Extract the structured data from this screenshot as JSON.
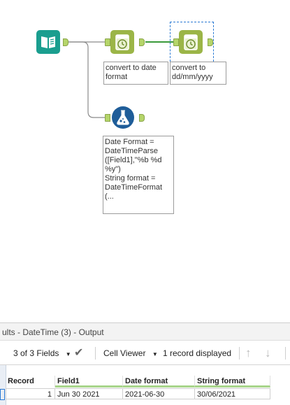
{
  "workflow": {
    "annotation_convert_date": "convert to date\nformat",
    "annotation_convert_ddmm": "convert to\ndd/mm/yyyy",
    "annotation_formula": "Date Format =\nDateTimeParse\n([Field1],\"%b %d\n%y\")\nString format =\nDateTimeFormat\n(..."
  },
  "results": {
    "title": "ults - DateTime (3) - Output",
    "fields_label": "3 of 3 Fields",
    "cell_viewer_label": "Cell Viewer",
    "records_label": "1 record displayed",
    "columns": [
      "Record",
      "Field1",
      "Date format",
      "String format"
    ],
    "rows": [
      [
        "1",
        "Jun 30 2021",
        "2021-06-30",
        "30/06/2021"
      ]
    ]
  },
  "colors": {
    "input_tool": "#1a9e8f",
    "datetime_tool": "#9bb547",
    "formula_tool": "#1f5d99",
    "anchor": "#b5d56a"
  },
  "icons": {
    "input": "book-icon",
    "datetime": "clock-icon",
    "formula": "flask-icon"
  }
}
